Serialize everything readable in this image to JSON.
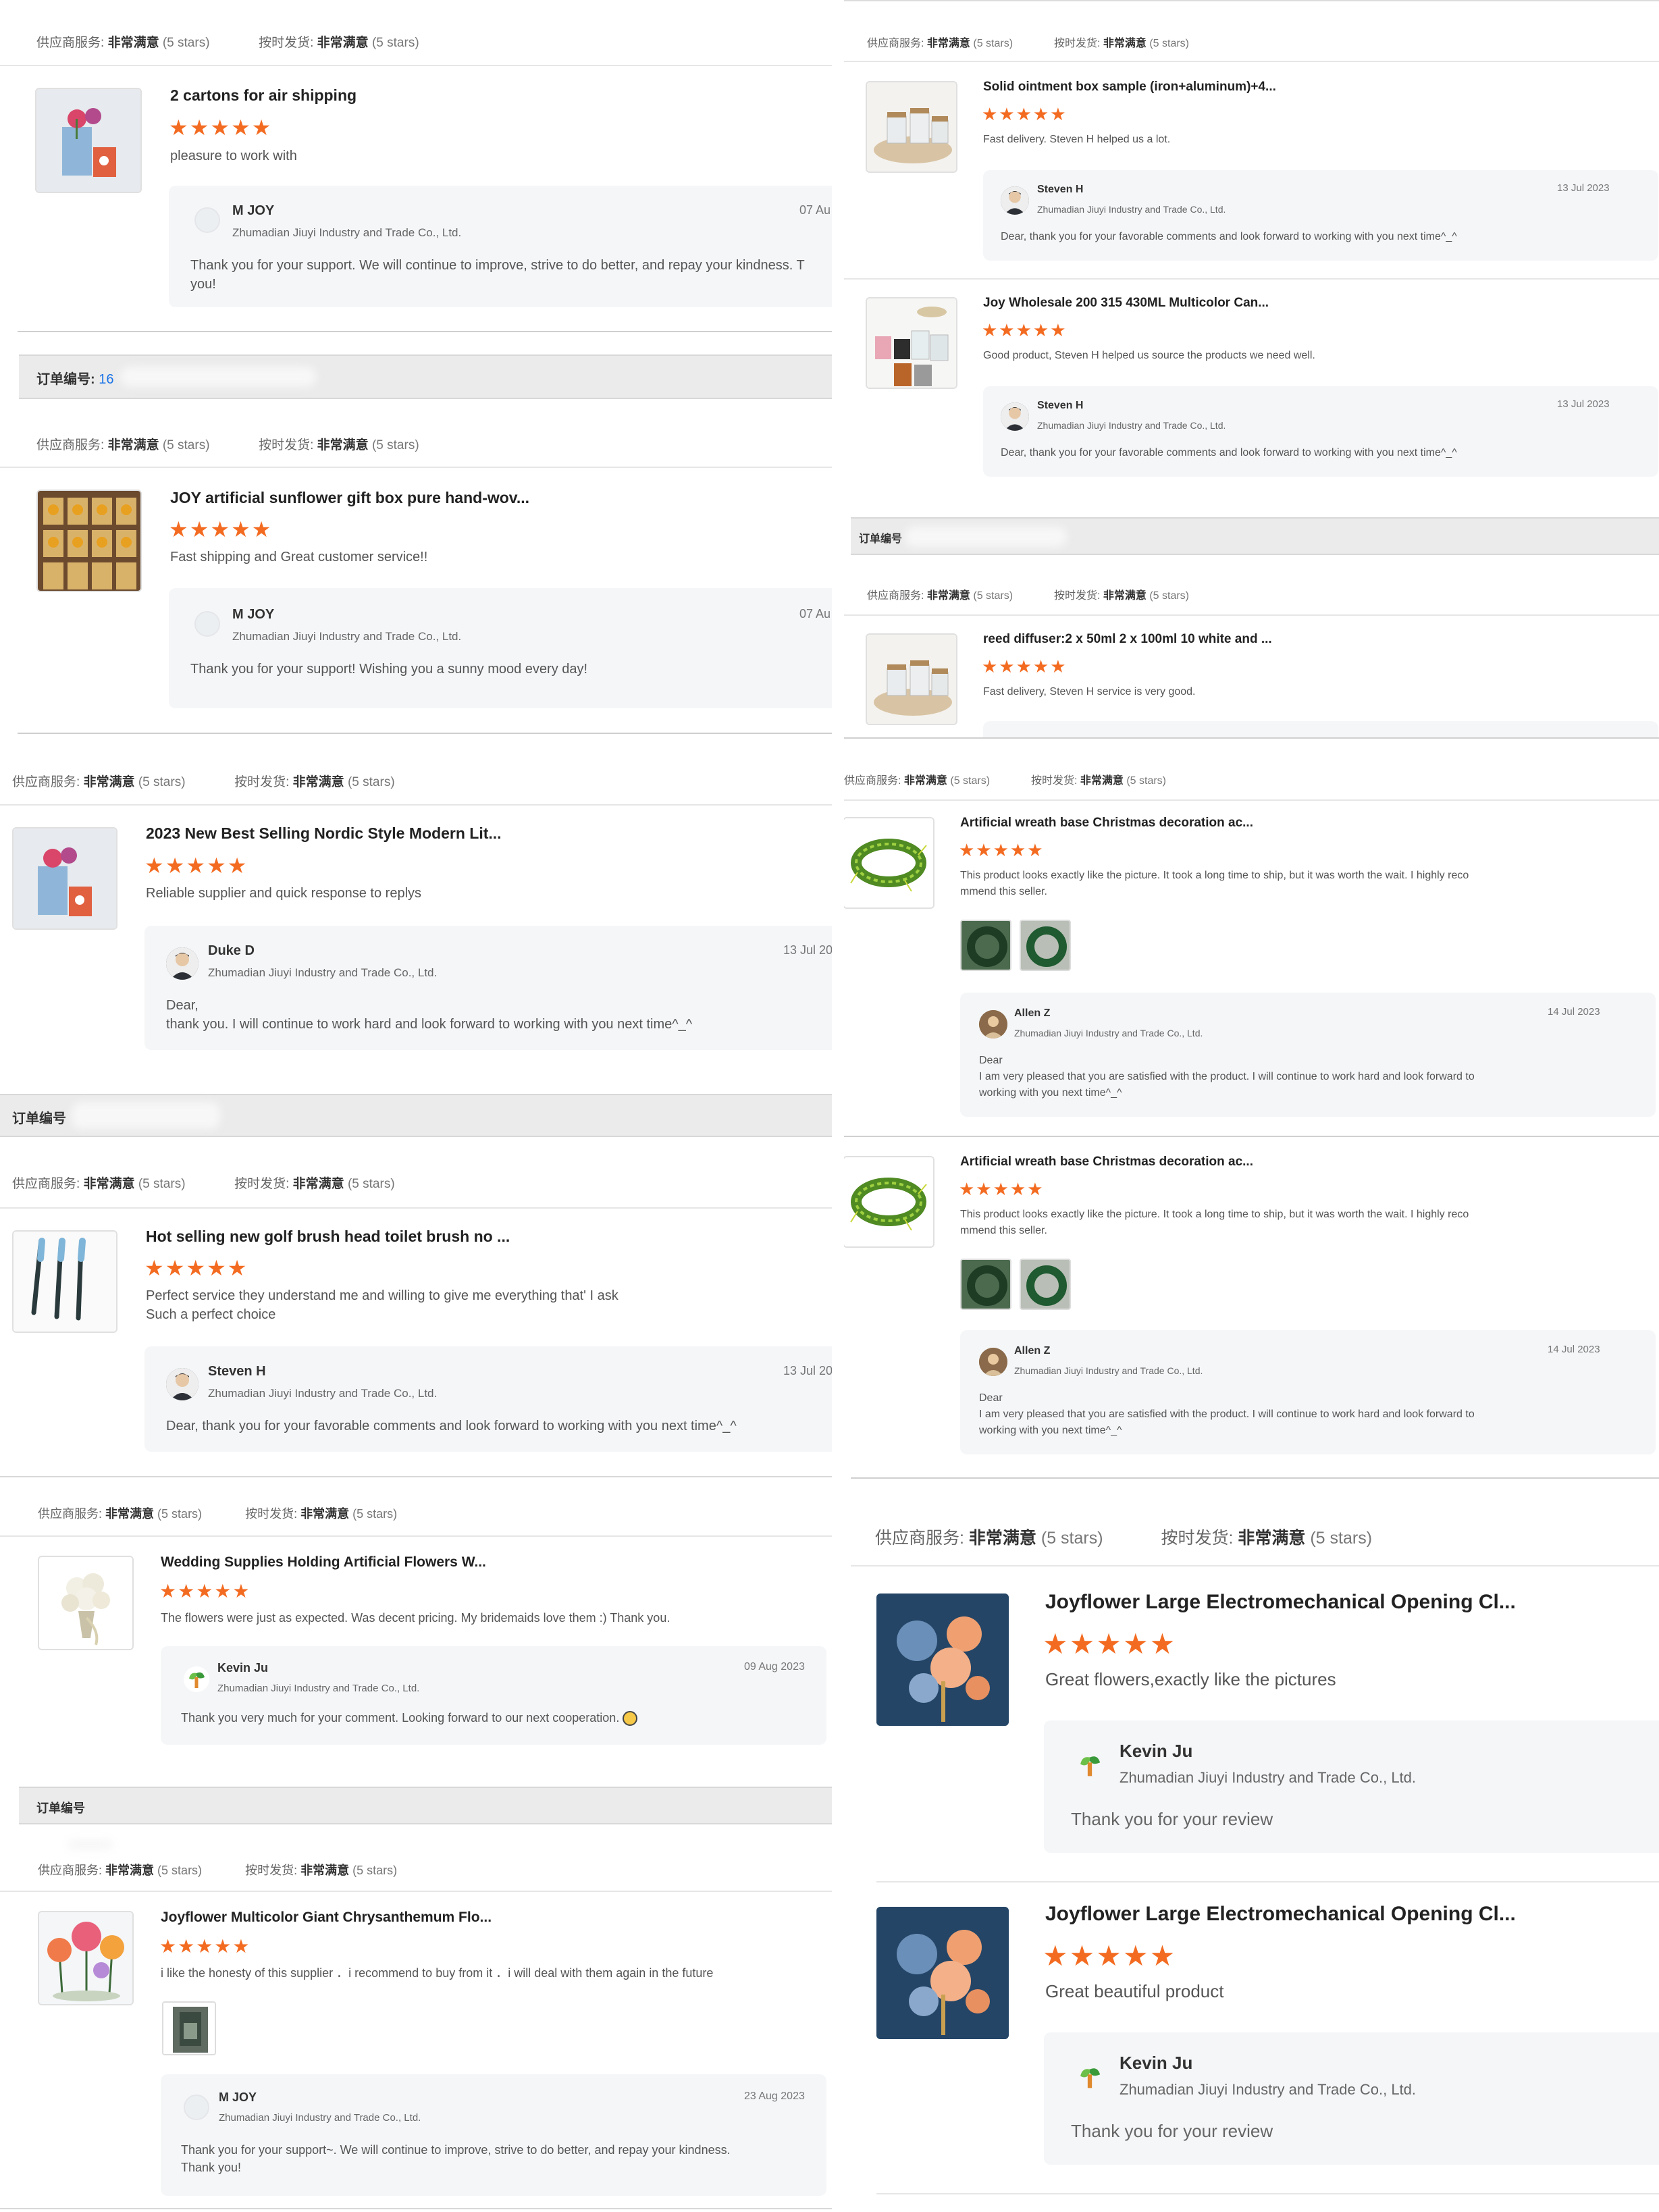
{
  "ratings": {
    "service_label": "供应商服务:",
    "delivery_label": "按时发货:",
    "value": "非常满意",
    "stars_text": "(5 stars)"
  },
  "order_label": "订单编号:",
  "order_label_short": "订单编号",
  "order_number_partial": "16",
  "colors": {
    "accent": "#f36b21",
    "link": "#1a73e8",
    "order_bar": "#ebebeb",
    "reply_bg": "#f5f6f8"
  },
  "stars": "★★★★★",
  "left": {
    "r1": {
      "title": "2 cartons for air shipping",
      "comment": "pleasure to work with",
      "reply_name": "M JOY",
      "company": "Zhumadian Jiuyi Industry and Trade Co., Ltd.",
      "date": "07 Au",
      "reply": "Thank you for your support. We will continue to improve, strive to do better, and repay your kindness. T you!"
    },
    "r2": {
      "title": "JOY artificial sunflower gift box pure hand-wov...",
      "comment": "Fast shipping and Great customer service!!",
      "reply_name": "M JOY",
      "company": "Zhumadian Jiuyi Industry and Trade Co., Ltd.",
      "date": "07 Au",
      "reply": "Thank you for your support! Wishing you a sunny mood every day!"
    },
    "r3": {
      "title": "2023 New Best Selling Nordic Style Modern Lit...",
      "comment": "Reliable supplier and quick response to replys",
      "reply_name": "Duke D",
      "company": "Zhumadian Jiuyi Industry and Trade Co., Ltd.",
      "date": "13 Jul 20",
      "reply_l1": "Dear,",
      "reply_l2": "thank you. I will continue to work hard and look forward to working with you next time^_^"
    },
    "r4": {
      "title": "Hot selling new golf brush head toilet brush no ...",
      "comment_l1": "Perfect service they understand me and willing to give me everything that' I ask",
      "comment_l2": "Such a perfect choice",
      "reply_name": "Steven H",
      "company": "Zhumadian Jiuyi Industry and Trade Co., Ltd.",
      "date": "13 Jul 20",
      "reply": "Dear, thank you for your favorable comments and look forward to working with you next time^_^"
    },
    "r5": {
      "title": "Wedding Supplies Holding Artificial Flowers W...",
      "comment": "The flowers were just as expected. Was decent pricing. My bridemaids love them :) Thank you.",
      "reply_name": "Kevin Ju",
      "company": "Zhumadian Jiuyi Industry and Trade Co., Ltd.",
      "date": "09 Aug 2023",
      "reply": "Thank you very much for your comment. Looking forward to our next cooperation."
    },
    "r6": {
      "title": "Joyflower Multicolor Giant Chrysanthemum Flo...",
      "comment": "i like the honesty of this supplier ．i recommend to buy from it ．i will deal with them again in the future",
      "reply_name": "M JOY",
      "company": "Zhumadian Jiuyi Industry and Trade Co., Ltd.",
      "date": "23 Aug 2023",
      "reply_l1": "Thank you for your support~. We will continue to improve, strive to do better, and repay your kindness.",
      "reply_l2": "Thank you!"
    }
  },
  "right": {
    "r1": {
      "title": "Solid ointment box sample (iron+aluminum)+4...",
      "comment": "Fast delivery. Steven H helped us a lot.",
      "reply_name": "Steven H",
      "company": "Zhumadian Jiuyi Industry and Trade Co., Ltd.",
      "date": "13 Jul 2023",
      "reply": "Dear, thank you for your favorable comments and look forward to working with you next time^_^"
    },
    "r2": {
      "title": "Joy Wholesale 200 315 430ML Multicolor Can...",
      "comment": "Good product, Steven H helped us source the products we need well.",
      "reply_name": "Steven H",
      "company": "Zhumadian Jiuyi Industry and Trade Co., Ltd.",
      "date": "13 Jul 2023",
      "reply": "Dear, thank you for your favorable comments and look forward to working with you next time^_^"
    },
    "r3": {
      "title": "reed diffuser:2 x 50ml 2 x 100ml 10 white and ...",
      "comment": "Fast delivery, Steven H service is very good."
    },
    "r4": {
      "title": "Artificial wreath base Christmas decoration ac...",
      "comment_l1": "This product looks exactly like the picture. It took a long time to ship, but it was worth the wait. I highly reco",
      "comment_l2": "mmend this seller.",
      "reply_name": "Allen Z",
      "company": "Zhumadian Jiuyi Industry and Trade Co., Ltd.",
      "date": "14 Jul 2023",
      "reply_l1": "Dear",
      "reply_l2": "I am very pleased that you are satisfied with the product. I will continue to work hard and look forward to",
      "reply_l3": "working with you next time^_^"
    },
    "r5": {
      "title": "Artificial wreath base Christmas decoration ac...",
      "comment_l1": "This product looks exactly like the picture. It took a long time to ship, but it was worth the wait. I highly reco",
      "comment_l2": "mmend this seller.",
      "reply_name": "Allen Z",
      "company": "Zhumadian Jiuyi Industry and Trade Co., Ltd.",
      "date": "14 Jul 2023",
      "reply_l1": "Dear",
      "reply_l2": "I am very pleased that you are satisfied with the product. I will continue to work hard and look forward to",
      "reply_l3": "working with you next time^_^"
    },
    "r6": {
      "title": "Joyflower Large Electromechanical Opening Cl...",
      "comment": "Great flowers,exactly like the pictures",
      "reply_name": "Kevin Ju",
      "company": "Zhumadian Jiuyi Industry and Trade Co., Ltd.",
      "reply": "Thank you for your review"
    },
    "r7": {
      "title": "Joyflower Large Electromechanical Opening Cl...",
      "comment": "Great beautiful product",
      "reply_name": "Kevin Ju",
      "company": "Zhumadian Jiuyi Industry and Trade Co., Ltd.",
      "reply": "Thank you for your review"
    }
  }
}
